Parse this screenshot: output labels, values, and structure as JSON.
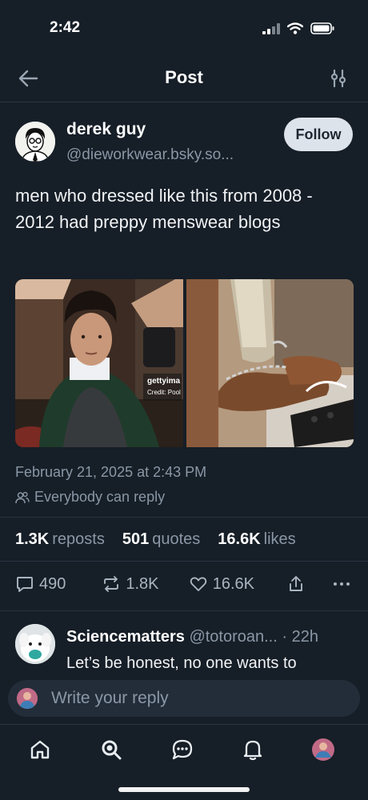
{
  "status_bar": {
    "time": "2:42"
  },
  "header": {
    "title": "Post"
  },
  "post": {
    "author_name": "derek guy",
    "author_handle": "@dieworkwear.bsky.so...",
    "follow_label": "Follow",
    "text": "men who dressed like this from 2008 - 2012 had preppy menswear blogs",
    "image_watermark": "gettyima",
    "image_credit": "Credit: Pool",
    "timestamp": "February 21, 2025 at 2:43 PM",
    "reply_permission": "Everybody can reply",
    "stats": {
      "reposts_count": "1.3K",
      "reposts_label": "reposts",
      "quotes_count": "501",
      "quotes_label": "quotes",
      "likes_count": "16.6K",
      "likes_label": "likes"
    },
    "actions": {
      "replies": "490",
      "reposts": "1.8K",
      "likes": "16.6K"
    }
  },
  "reply": {
    "author_name": "Sciencematters",
    "author_handle": "@totoroan...",
    "time": "· 22h",
    "text": "Let’s be honest, no one wants to"
  },
  "composer": {
    "placeholder": "Write your reply"
  },
  "tabbar": {
    "items": [
      "home-icon",
      "search-icon",
      "chat-icon",
      "bell-icon",
      "profile-avatar"
    ]
  },
  "colors": {
    "background": "#161e27",
    "muted": "#8a97a6",
    "follow_bg": "#dde3ea"
  }
}
